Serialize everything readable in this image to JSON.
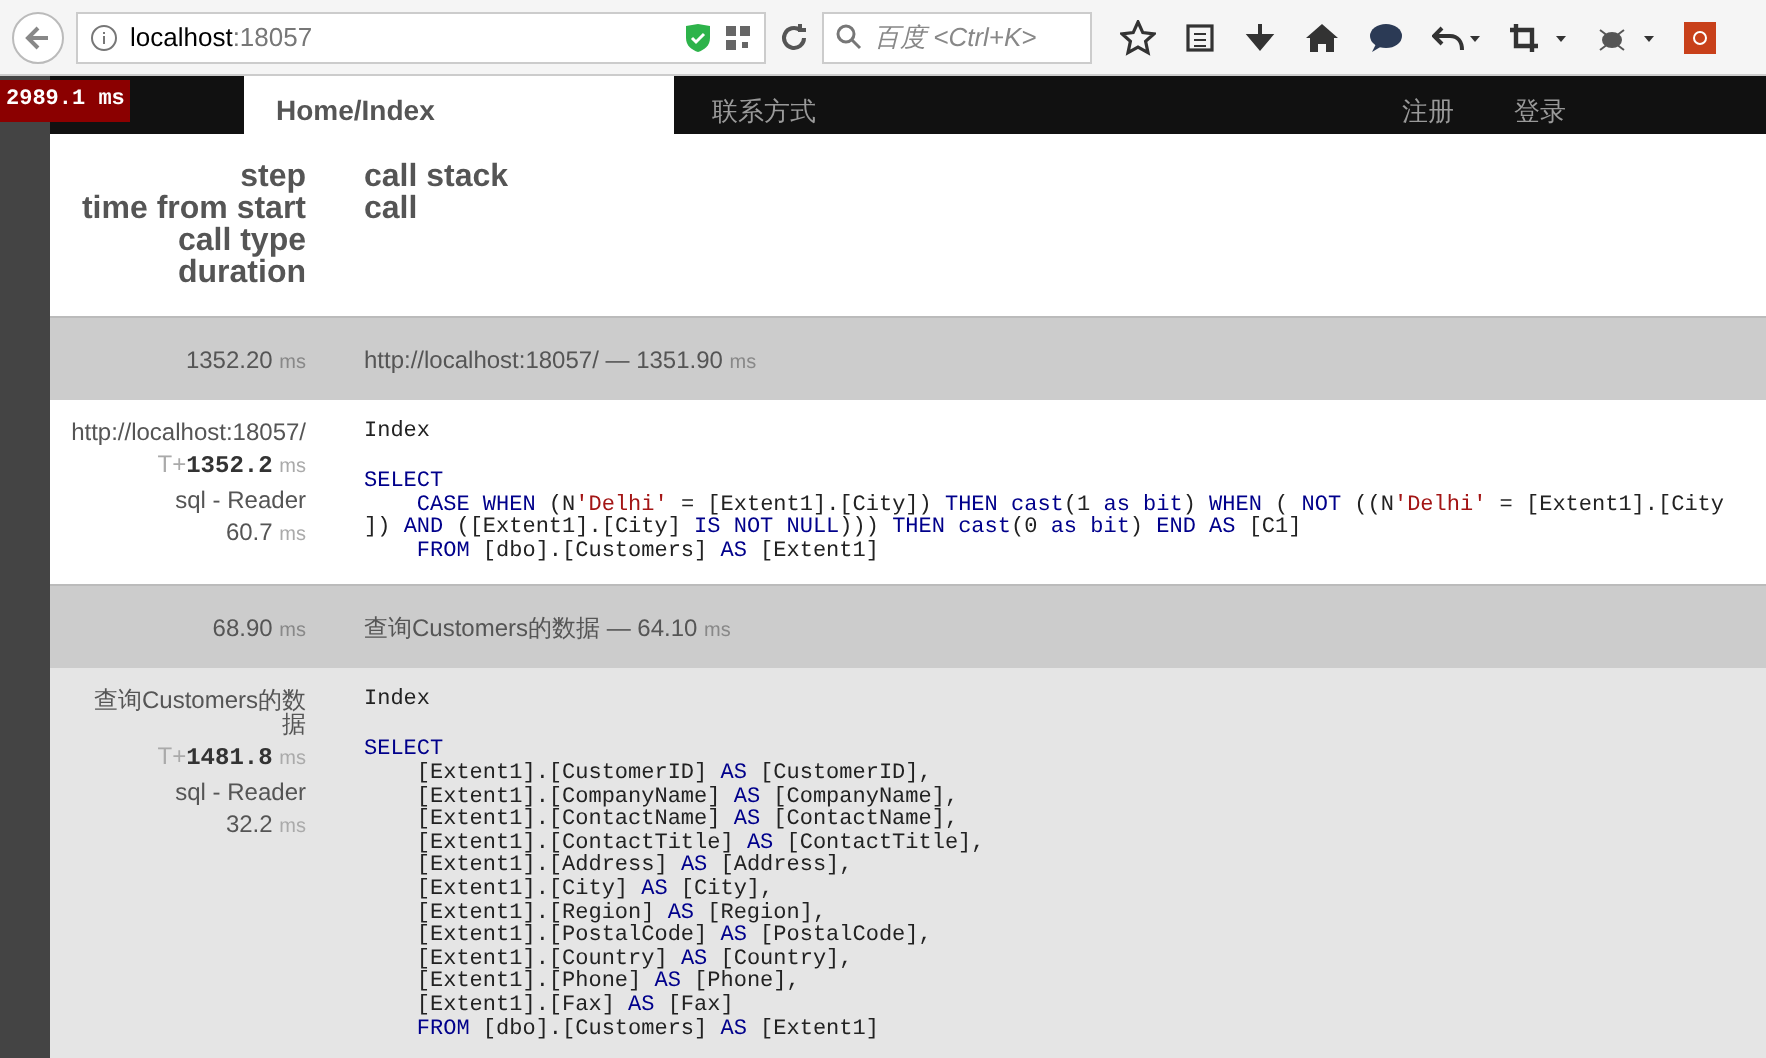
{
  "browser": {
    "url_host": "localhost",
    "url_port": ":18057",
    "search_placeholder": "百度 <Ctrl+K>"
  },
  "profiler": {
    "total": "2989.1 ms",
    "page_title": "Home/Index"
  },
  "site_nav": {
    "brand_link": "联系方式",
    "links": [
      "注册",
      "登录"
    ]
  },
  "header": {
    "left": [
      "step",
      "time from start",
      "call type",
      "duration"
    ],
    "right": [
      "call stack",
      "call"
    ]
  },
  "rows": [
    {
      "kind": "group",
      "duration": "1352.20",
      "unit": "ms",
      "title": "http://localhost:18057/ — 1351.90",
      "title_unit": "ms"
    },
    {
      "kind": "step",
      "striped": false,
      "step": "http://localhost:18057/",
      "time_prefix": "T+",
      "time": "1352.2",
      "time_unit": "ms",
      "call_type": "sql - Reader",
      "duration": "60.7",
      "unit": "ms",
      "call": "Index",
      "sql": [
        [
          {
            "kind": "kw",
            "text": "SELECT"
          }
        ],
        [
          {
            "kind": "kw",
            "text": "    CASE WHEN"
          },
          {
            "kind": "plain",
            "text": " (N"
          },
          {
            "kind": "str",
            "text": "'Delhi'"
          },
          {
            "kind": "plain",
            "text": " = [Extent1].[City]) "
          },
          {
            "kind": "kw",
            "text": "THEN cast"
          },
          {
            "kind": "plain",
            "text": "(1 "
          },
          {
            "kind": "kw",
            "text": "as bit"
          },
          {
            "kind": "plain",
            "text": ") "
          },
          {
            "kind": "kw",
            "text": "WHEN"
          },
          {
            "kind": "plain",
            "text": " ( "
          },
          {
            "kind": "kw",
            "text": "NOT"
          },
          {
            "kind": "plain",
            "text": " ((N"
          },
          {
            "kind": "str",
            "text": "'Delhi'"
          },
          {
            "kind": "plain",
            "text": " = [Extent1].[City"
          }
        ],
        [
          {
            "kind": "plain",
            "text": "]) "
          },
          {
            "kind": "kw",
            "text": "AND"
          },
          {
            "kind": "plain",
            "text": " ([Extent1].[City] "
          },
          {
            "kind": "kw",
            "text": "IS NOT NULL"
          },
          {
            "kind": "plain",
            "text": "))) "
          },
          {
            "kind": "kw",
            "text": "THEN cast"
          },
          {
            "kind": "plain",
            "text": "(0 "
          },
          {
            "kind": "kw",
            "text": "as bit"
          },
          {
            "kind": "plain",
            "text": ") "
          },
          {
            "kind": "kw",
            "text": "END AS"
          },
          {
            "kind": "plain",
            "text": " [C1]"
          }
        ],
        [
          {
            "kind": "kw",
            "text": "    FROM"
          },
          {
            "kind": "plain",
            "text": " [dbo].[Customers] "
          },
          {
            "kind": "kw",
            "text": "AS"
          },
          {
            "kind": "plain",
            "text": " [Extent1]"
          }
        ]
      ]
    },
    {
      "kind": "group",
      "duration": "68.90",
      "unit": "ms",
      "title": "查询Customers的数据 — 64.10",
      "title_unit": "ms"
    },
    {
      "kind": "step",
      "striped": true,
      "step": "查询Customers的数据",
      "time_prefix": "T+",
      "time": "1481.8",
      "time_unit": "ms",
      "call_type": "sql - Reader",
      "duration": "32.2",
      "unit": "ms",
      "call": "Index",
      "sql": [
        [
          {
            "kind": "kw",
            "text": "SELECT"
          }
        ],
        [
          {
            "kind": "plain",
            "text": "    [Extent1].[CustomerID] "
          },
          {
            "kind": "kw",
            "text": "AS"
          },
          {
            "kind": "plain",
            "text": " [CustomerID],"
          }
        ],
        [
          {
            "kind": "plain",
            "text": "    [Extent1].[CompanyName] "
          },
          {
            "kind": "kw",
            "text": "AS"
          },
          {
            "kind": "plain",
            "text": " [CompanyName],"
          }
        ],
        [
          {
            "kind": "plain",
            "text": "    [Extent1].[ContactName] "
          },
          {
            "kind": "kw",
            "text": "AS"
          },
          {
            "kind": "plain",
            "text": " [ContactName],"
          }
        ],
        [
          {
            "kind": "plain",
            "text": "    [Extent1].[ContactTitle] "
          },
          {
            "kind": "kw",
            "text": "AS"
          },
          {
            "kind": "plain",
            "text": " [ContactTitle],"
          }
        ],
        [
          {
            "kind": "plain",
            "text": "    [Extent1].[Address] "
          },
          {
            "kind": "kw",
            "text": "AS"
          },
          {
            "kind": "plain",
            "text": " [Address],"
          }
        ],
        [
          {
            "kind": "plain",
            "text": "    [Extent1].[City] "
          },
          {
            "kind": "kw",
            "text": "AS"
          },
          {
            "kind": "plain",
            "text": " [City],"
          }
        ],
        [
          {
            "kind": "plain",
            "text": "    [Extent1].[Region] "
          },
          {
            "kind": "kw",
            "text": "AS"
          },
          {
            "kind": "plain",
            "text": " [Region],"
          }
        ],
        [
          {
            "kind": "plain",
            "text": "    [Extent1].[PostalCode] "
          },
          {
            "kind": "kw",
            "text": "AS"
          },
          {
            "kind": "plain",
            "text": " [PostalCode],"
          }
        ],
        [
          {
            "kind": "plain",
            "text": "    [Extent1].[Country] "
          },
          {
            "kind": "kw",
            "text": "AS"
          },
          {
            "kind": "plain",
            "text": " [Country],"
          }
        ],
        [
          {
            "kind": "plain",
            "text": "    [Extent1].[Phone] "
          },
          {
            "kind": "kw",
            "text": "AS"
          },
          {
            "kind": "plain",
            "text": " [Phone],"
          }
        ],
        [
          {
            "kind": "plain",
            "text": "    [Extent1].[Fax] "
          },
          {
            "kind": "kw",
            "text": "AS"
          },
          {
            "kind": "plain",
            "text": " [Fax]"
          }
        ],
        [
          {
            "kind": "kw",
            "text": "    FROM"
          },
          {
            "kind": "plain",
            "text": " [dbo].[Customers] "
          },
          {
            "kind": "kw",
            "text": "AS"
          },
          {
            "kind": "plain",
            "text": " [Extent1]"
          }
        ]
      ]
    }
  ]
}
